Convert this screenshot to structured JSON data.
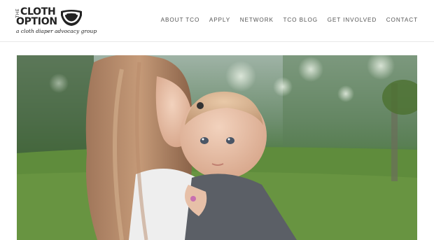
{
  "logo": {
    "the": "THE",
    "line1": "CLOTH",
    "line2": "OPTION",
    "tagline": "a cloth diaper advocacy group"
  },
  "nav": {
    "items": [
      {
        "label": "ABOUT TCO"
      },
      {
        "label": "APPLY"
      },
      {
        "label": "NETWORK"
      },
      {
        "label": "TCO BLOG"
      },
      {
        "label": "GET INVOLVED"
      },
      {
        "label": "CONTACT"
      }
    ]
  },
  "hero": {
    "icon": "photo-mother-kissing-baby"
  },
  "colors": {
    "text": "#222222",
    "nav": "#555555",
    "divider": "#e8e8e8",
    "background": "#ffffff"
  }
}
